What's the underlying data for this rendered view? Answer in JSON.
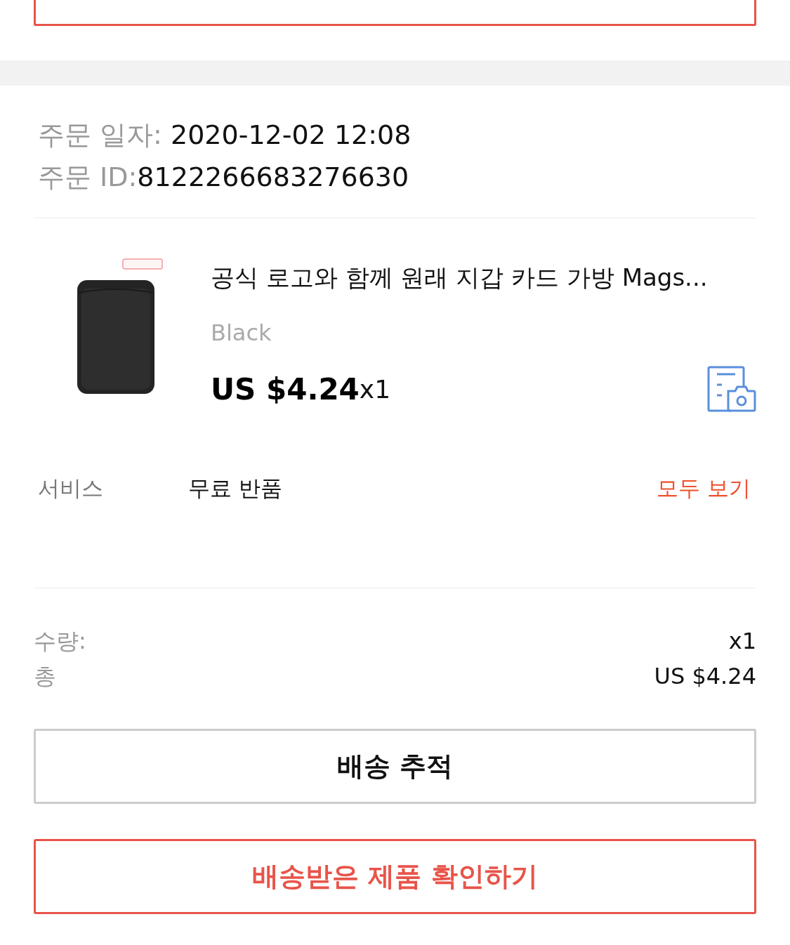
{
  "order": {
    "date_label": "주문 일자:",
    "date": "2020-12-02 12:08",
    "id_label": "주문 ID:",
    "id": "8122266683276630"
  },
  "product": {
    "title": "공식 로고와 함께 원래 지갑 카드 가방 Mags...",
    "variant": "Black",
    "price": "US $4.24",
    "quantity": "x1"
  },
  "service": {
    "label": "서비스",
    "value": "무료 반품",
    "link": "모두 보기"
  },
  "summary": [
    {
      "label": "수량:",
      "value": "x1"
    },
    {
      "label": "총",
      "value": "US $4.24"
    }
  ],
  "buttons": [
    {
      "label": "배송 추적",
      "kind": "secondary"
    },
    {
      "label": "배송받은 제품 확인하기",
      "kind": "primary"
    }
  ]
}
